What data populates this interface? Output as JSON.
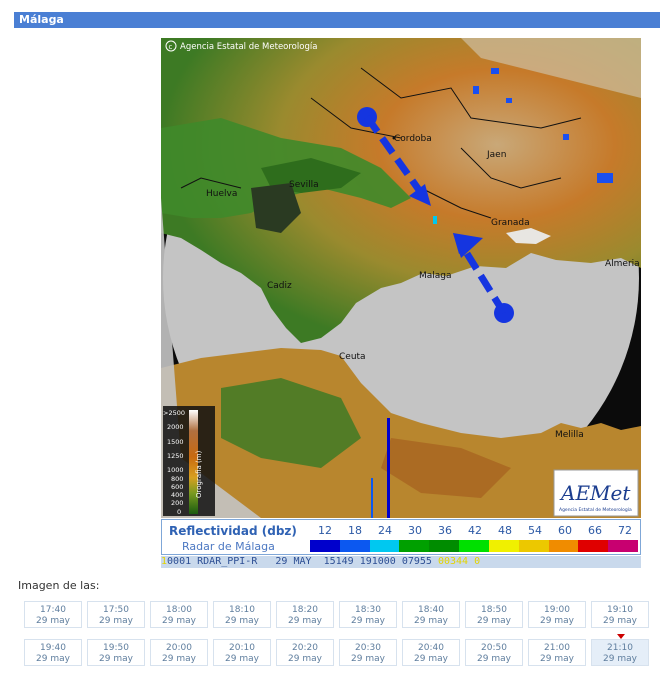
{
  "header": {
    "title": "Málaga"
  },
  "radar": {
    "copyright": "Agencia Estatal de Meteorología",
    "cities": [
      "Cordoba",
      "Jaen",
      "Huelva",
      "Sevilla",
      "Granada",
      "Almeria",
      "Cadiz",
      "Malaga",
      "Ceuta",
      "Melilla"
    ],
    "orography": {
      "unit_label": "Orografia (m)",
      "ticks": [
        ">2500",
        "2000",
        "1500",
        "1250",
        "1000",
        "800",
        "600",
        "400",
        "200",
        "0"
      ]
    },
    "logo": {
      "text": "AEMet",
      "subtitle": "Agencia Estatal de Meteorología"
    }
  },
  "legend": {
    "title": "Reflectividad (dbz)",
    "subtitle": "Radar de Málaga",
    "values": [
      "12",
      "18",
      "24",
      "30",
      "36",
      "42",
      "48",
      "54",
      "60",
      "66",
      "72"
    ],
    "colors": [
      "#0000cc",
      "#0c58f0",
      "#00c8f0",
      "#00a000",
      "#008c00",
      "#00e000",
      "#f0f000",
      "#ecc800",
      "#f08c00",
      "#e00000",
      "#c80070"
    ]
  },
  "ticker": {
    "text": "0001 RDAR_PPI-R   29 MAY  15149 191000 07955 ",
    "tail": "00344 0",
    "prefix": "1"
  },
  "times_label": "Imagen de las:",
  "times": {
    "row1": [
      {
        "time": "17:40",
        "date": "29 may"
      },
      {
        "time": "17:50",
        "date": "29 may"
      },
      {
        "time": "18:00",
        "date": "29 may"
      },
      {
        "time": "18:10",
        "date": "29 may"
      },
      {
        "time": "18:20",
        "date": "29 may"
      },
      {
        "time": "18:30",
        "date": "29 may"
      },
      {
        "time": "18:40",
        "date": "29 may"
      },
      {
        "time": "18:50",
        "date": "29 may"
      },
      {
        "time": "19:00",
        "date": "29 may"
      },
      {
        "time": "19:10",
        "date": "29 may"
      }
    ],
    "row2": [
      {
        "time": "19:40",
        "date": "29 may"
      },
      {
        "time": "19:50",
        "date": "29 may"
      },
      {
        "time": "20:00",
        "date": "29 may"
      },
      {
        "time": "20:10",
        "date": "29 may"
      },
      {
        "time": "20:20",
        "date": "29 may"
      },
      {
        "time": "20:30",
        "date": "29 may"
      },
      {
        "time": "20:40",
        "date": "29 may"
      },
      {
        "time": "20:50",
        "date": "29 may"
      },
      {
        "time": "21:00",
        "date": "29 may"
      },
      {
        "time": "21:10",
        "date": "29 may"
      }
    ],
    "selected": "21:10"
  }
}
